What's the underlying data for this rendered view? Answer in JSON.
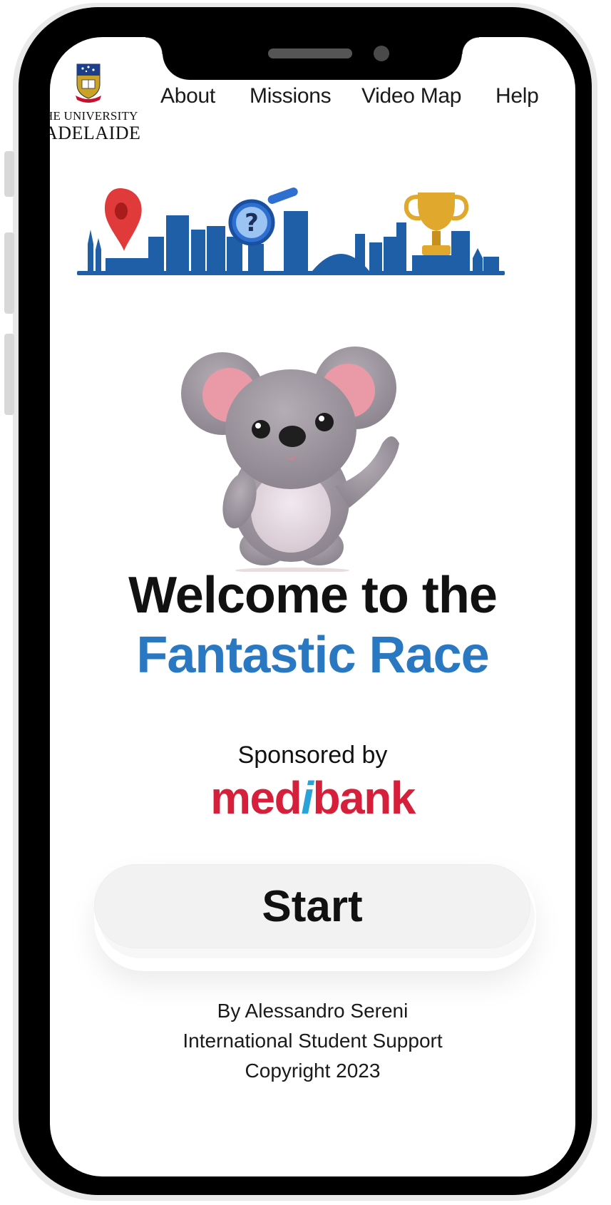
{
  "header": {
    "logo": {
      "line1": "HE UNIVERSITY",
      "line2": "ADELAIDE"
    },
    "nav": [
      "About",
      "Missions",
      "Video Map",
      "Help"
    ]
  },
  "hero": {
    "title_line1": "Welcome to the",
    "title_line2": "Fantastic Race",
    "title_line2_color": "#2a78c2"
  },
  "sponsor": {
    "label": "Sponsored by",
    "brand_pre": "med",
    "brand_i": "i",
    "brand_post": "bank",
    "brand_color": "#d61f3a"
  },
  "start_button": {
    "label": "Start"
  },
  "footer": {
    "author": "By Alessandro Sereni",
    "org": "International Student Support",
    "copyright": "Copyright 2023"
  },
  "colors": {
    "skyline": "#1f5fa8",
    "pin": "#e03a3a",
    "trophy": "#d9a52b"
  }
}
